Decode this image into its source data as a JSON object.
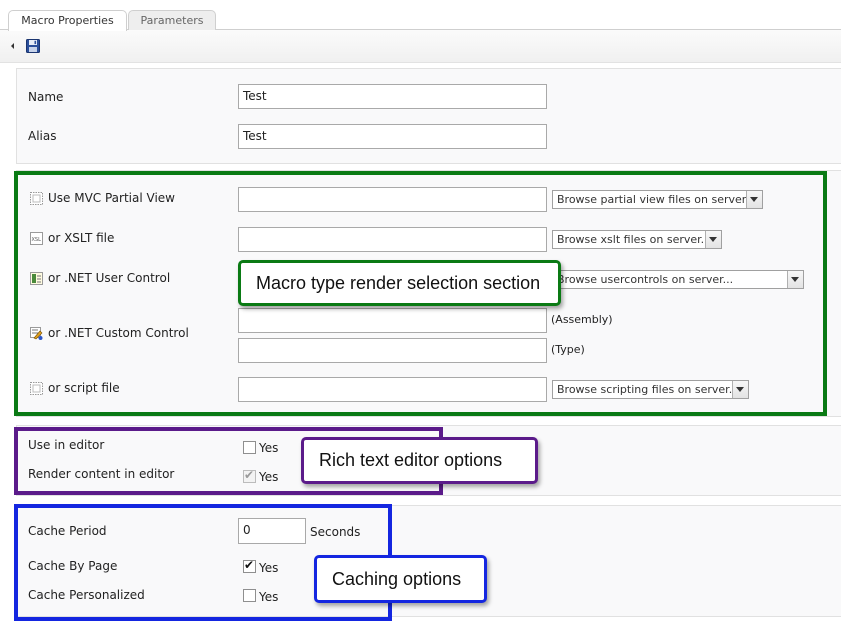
{
  "tabs": [
    {
      "label": "Macro Properties",
      "active": true
    },
    {
      "label": "Parameters",
      "active": false
    }
  ],
  "toolbar": {
    "back_icon": "triangle-left-icon",
    "save_icon": "floppy-disk-icon"
  },
  "properties": {
    "name_label": "Name",
    "name_value": "Test",
    "alias_label": "Alias",
    "alias_value": "Test"
  },
  "render": {
    "mvc_label": "Use MVC Partial View",
    "mvc_browse": "Browse partial view files on server...",
    "xslt_label": "or XSLT file",
    "xslt_browse": "Browse xslt files on server...",
    "usercontrol_label": "or .NET User Control",
    "usercontrol_browse": "Browse usercontrols on server...",
    "customcontrol_label": "or .NET Custom Control",
    "assembly_label": "(Assembly)",
    "type_label": "(Type)",
    "script_label": "or script file",
    "script_browse": "Browse scripting files on server..."
  },
  "editor": {
    "use_label": "Use in editor",
    "use_checked": false,
    "render_label": "Render content in editor",
    "render_checked": true,
    "yes": "Yes"
  },
  "cache": {
    "period_label": "Cache Period",
    "period_value": "0",
    "seconds": "Seconds",
    "bypage_label": "Cache By Page",
    "bypage_checked": true,
    "personalized_label": "Cache Personalized",
    "personalized_checked": false,
    "yes": "Yes"
  },
  "annotations": {
    "render_section": "Macro type render selection section",
    "editor_section": "Rich text editor options",
    "cache_section": "Caching options",
    "render_color": "#0a7a14",
    "editor_color": "#5b1b8a",
    "cache_color": "#1426e0"
  }
}
